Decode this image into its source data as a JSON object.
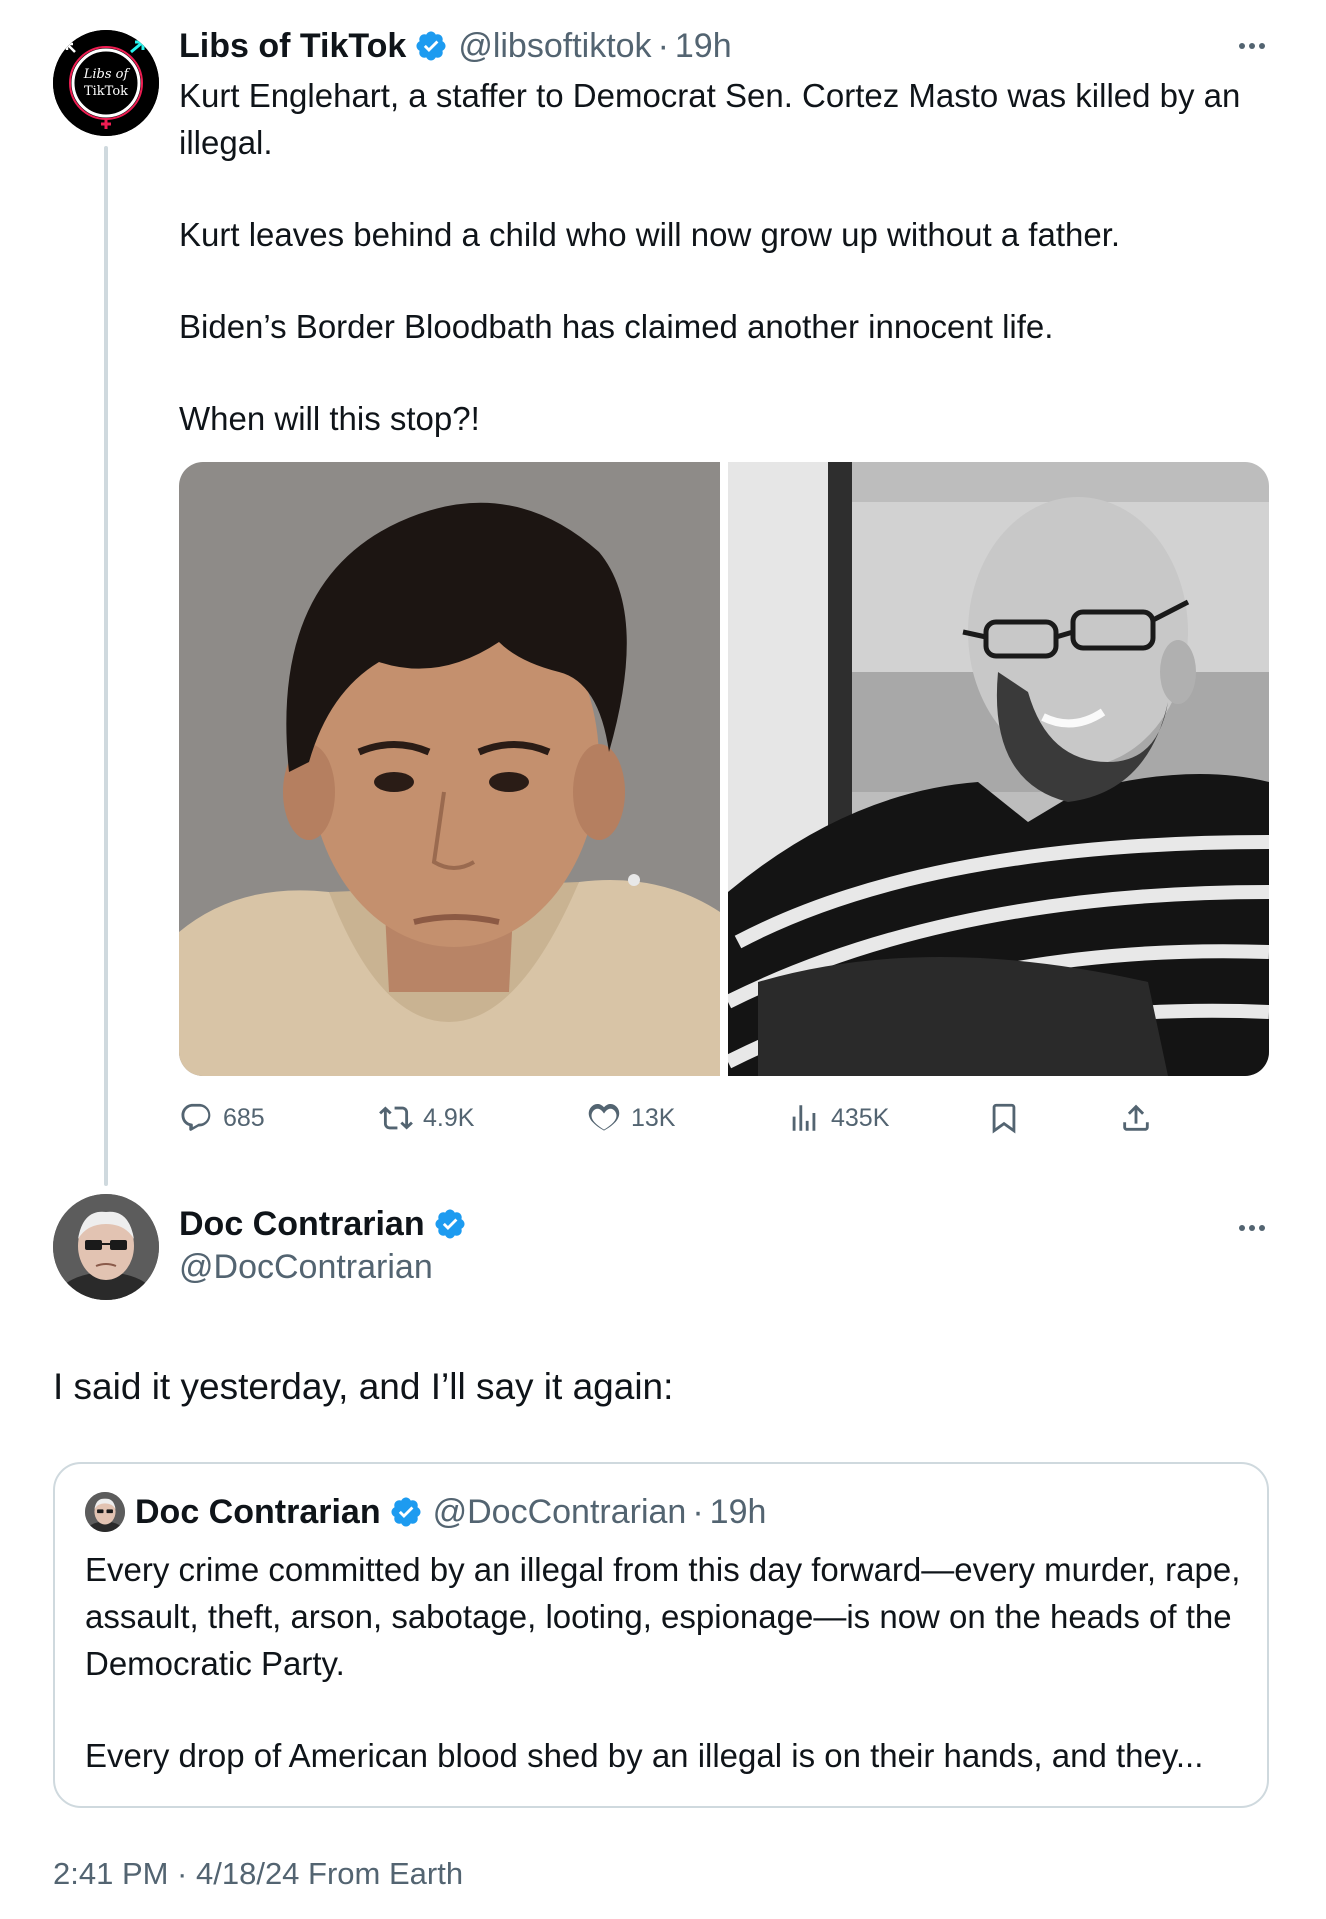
{
  "tweet": {
    "author": {
      "name": "Libs of TikTok",
      "handle": "@libsoftiktok",
      "time": "19h",
      "avatar_text_line1": "Libs of",
      "avatar_text_line2": "TikTok"
    },
    "paragraphs": [
      "Kurt Englehart, a staffer to Democrat Sen. Cortez Masto was killed by an illegal.",
      "Kurt leaves behind a child who will now grow up without a father.",
      "Biden’s Border Bloodbath has claimed another innocent life.",
      "When will this stop?!"
    ],
    "stats": {
      "replies": "685",
      "retweets": "4.9K",
      "likes": "13K",
      "views": "435K"
    }
  },
  "reply": {
    "author": {
      "name": "Doc Contrarian",
      "handle": "@DocContrarian"
    },
    "text": "I said it yesterday, and I’ll say it again:",
    "quote": {
      "name": "Doc Contrarian",
      "handle": "@DocContrarian",
      "time": "19h",
      "paragraphs": [
        "Every crime committed by an illegal from this day forward—every murder, rape, assault, theft, arson, sabotage, looting, espionage—is now on the heads of the Democratic Party.",
        "Every drop of American blood shed by an illegal is on their hands, and they..."
      ]
    },
    "footer": "2:41 PM · 4/18/24 From Earth"
  },
  "colors": {
    "text": "#0f1419",
    "secondary": "#536471",
    "verified": "#1d9bf0",
    "border": "#cfd9de"
  },
  "separator": "·"
}
